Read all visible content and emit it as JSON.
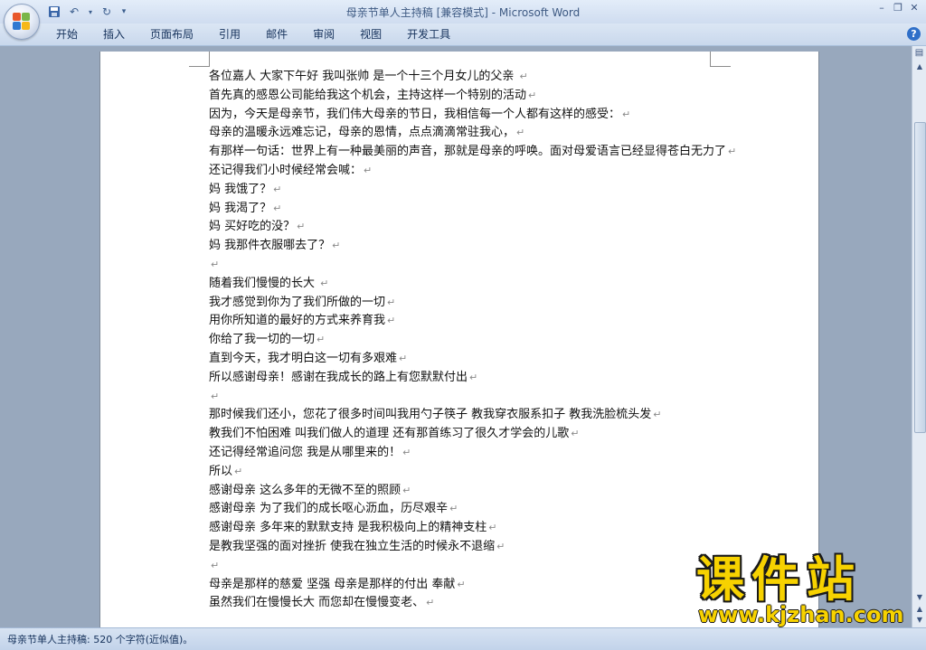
{
  "window": {
    "title": "母亲节单人主持稿 [兼容模式] - Microsoft Word"
  },
  "quick_access": {
    "save_icon": "save-icon",
    "undo_icon": "undo-icon",
    "redo_icon": "redo-icon",
    "customize_icon": "customize-qat-icon"
  },
  "window_controls": {
    "minimize": "–",
    "restore": "❐",
    "close": "✕"
  },
  "ribbon": {
    "tabs": [
      {
        "label": "开始"
      },
      {
        "label": "插入"
      },
      {
        "label": "页面布局"
      },
      {
        "label": "引用"
      },
      {
        "label": "邮件"
      },
      {
        "label": "审阅"
      },
      {
        "label": "视图"
      },
      {
        "label": "开发工具"
      }
    ],
    "help": "?"
  },
  "document": {
    "paragraph_mark": "↵",
    "lines": [
      "各位嘉人 大家下午好 我叫张帅 是一个十三个月女儿的父亲 ",
      "首先真的感恩公司能给我这个机会，主持这样一个特别的活动",
      "因为，今天是母亲节，我们伟大母亲的节日，我相信每一个人都有这样的感受：",
      "母亲的温暖永远难忘记，母亲的恩情，点点滴滴常驻我心，",
      "有那样一句话：世界上有一种最美丽的声音，那就是母亲的呼唤。面对母爱语言已经显得苍白无力了",
      "还记得我们小时候经常会喊：",
      "妈 我饿了？",
      "妈 我渴了？",
      "妈 买好吃的没？",
      "妈 我那件衣服哪去了？",
      "",
      "随着我们慢慢的长大 ",
      "我才感觉到你为了我们所做的一切",
      "用你所知道的最好的方式来养育我",
      "你给了我一切的一切",
      "直到今天，我才明白这一切有多艰难",
      "所以感谢母亲！感谢在我成长的路上有您默默付出",
      "",
      "那时候我们还小，您花了很多时间叫我用勺子筷子 教我穿衣服系扣子 教我洗脸梳头发",
      "教我们不怕困难 叫我们做人的道理 还有那首练习了很久才学会的儿歌",
      "还记得经常追问您 我是从哪里来的！",
      "所以",
      "感谢母亲 这么多年的无微不至的照顾",
      "感谢母亲 为了我们的成长呕心沥血，历尽艰辛",
      "感谢母亲 多年来的默默支持 是我积极向上的精神支柱",
      "是教我坚强的面对挫折 使我在独立生活的时候永不退缩",
      "",
      "母亲是那样的慈爱 坚强 母亲是那样的付出 奉献",
      "虽然我们在慢慢长大 而您却在慢慢变老、"
    ]
  },
  "status_bar": {
    "text": "母亲节单人主持稿: 520 个字符(近似值)。"
  },
  "watermark": {
    "chinese": "课件站",
    "url": "www.kjzhan.com"
  }
}
